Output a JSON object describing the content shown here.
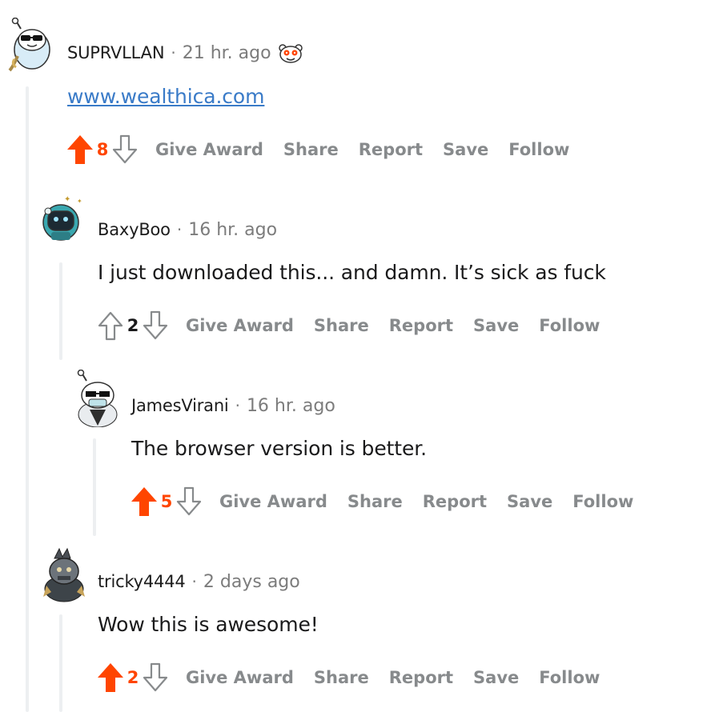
{
  "comments": [
    {
      "author": "SUPRVLLAN",
      "time": "21 hr. ago",
      "link": "www.wealthica.com",
      "score": "8",
      "upvoted": true,
      "has_award": true
    },
    {
      "author": "BaxyBoo",
      "time": "16 hr. ago",
      "text": "I just downloaded this... and damn. It’s sick as fuck",
      "score": "2",
      "upvoted": false
    },
    {
      "author": "JamesVirani",
      "time": "16 hr. ago",
      "text": "The browser version is better.",
      "score": "5",
      "upvoted": true
    },
    {
      "author": "tricky4444",
      "time": "2 days ago",
      "text": "Wow this is awesome!",
      "score": "2",
      "upvoted": true
    }
  ],
  "actions": {
    "give_award": "Give Award",
    "share": "Share",
    "report": "Report",
    "save": "Save",
    "follow": "Follow"
  },
  "separator": "·",
  "colors": {
    "upvote": "#ff4500",
    "action_text": "#878a8c",
    "link": "#3a7bc8",
    "thread_line": "#edeff1"
  }
}
